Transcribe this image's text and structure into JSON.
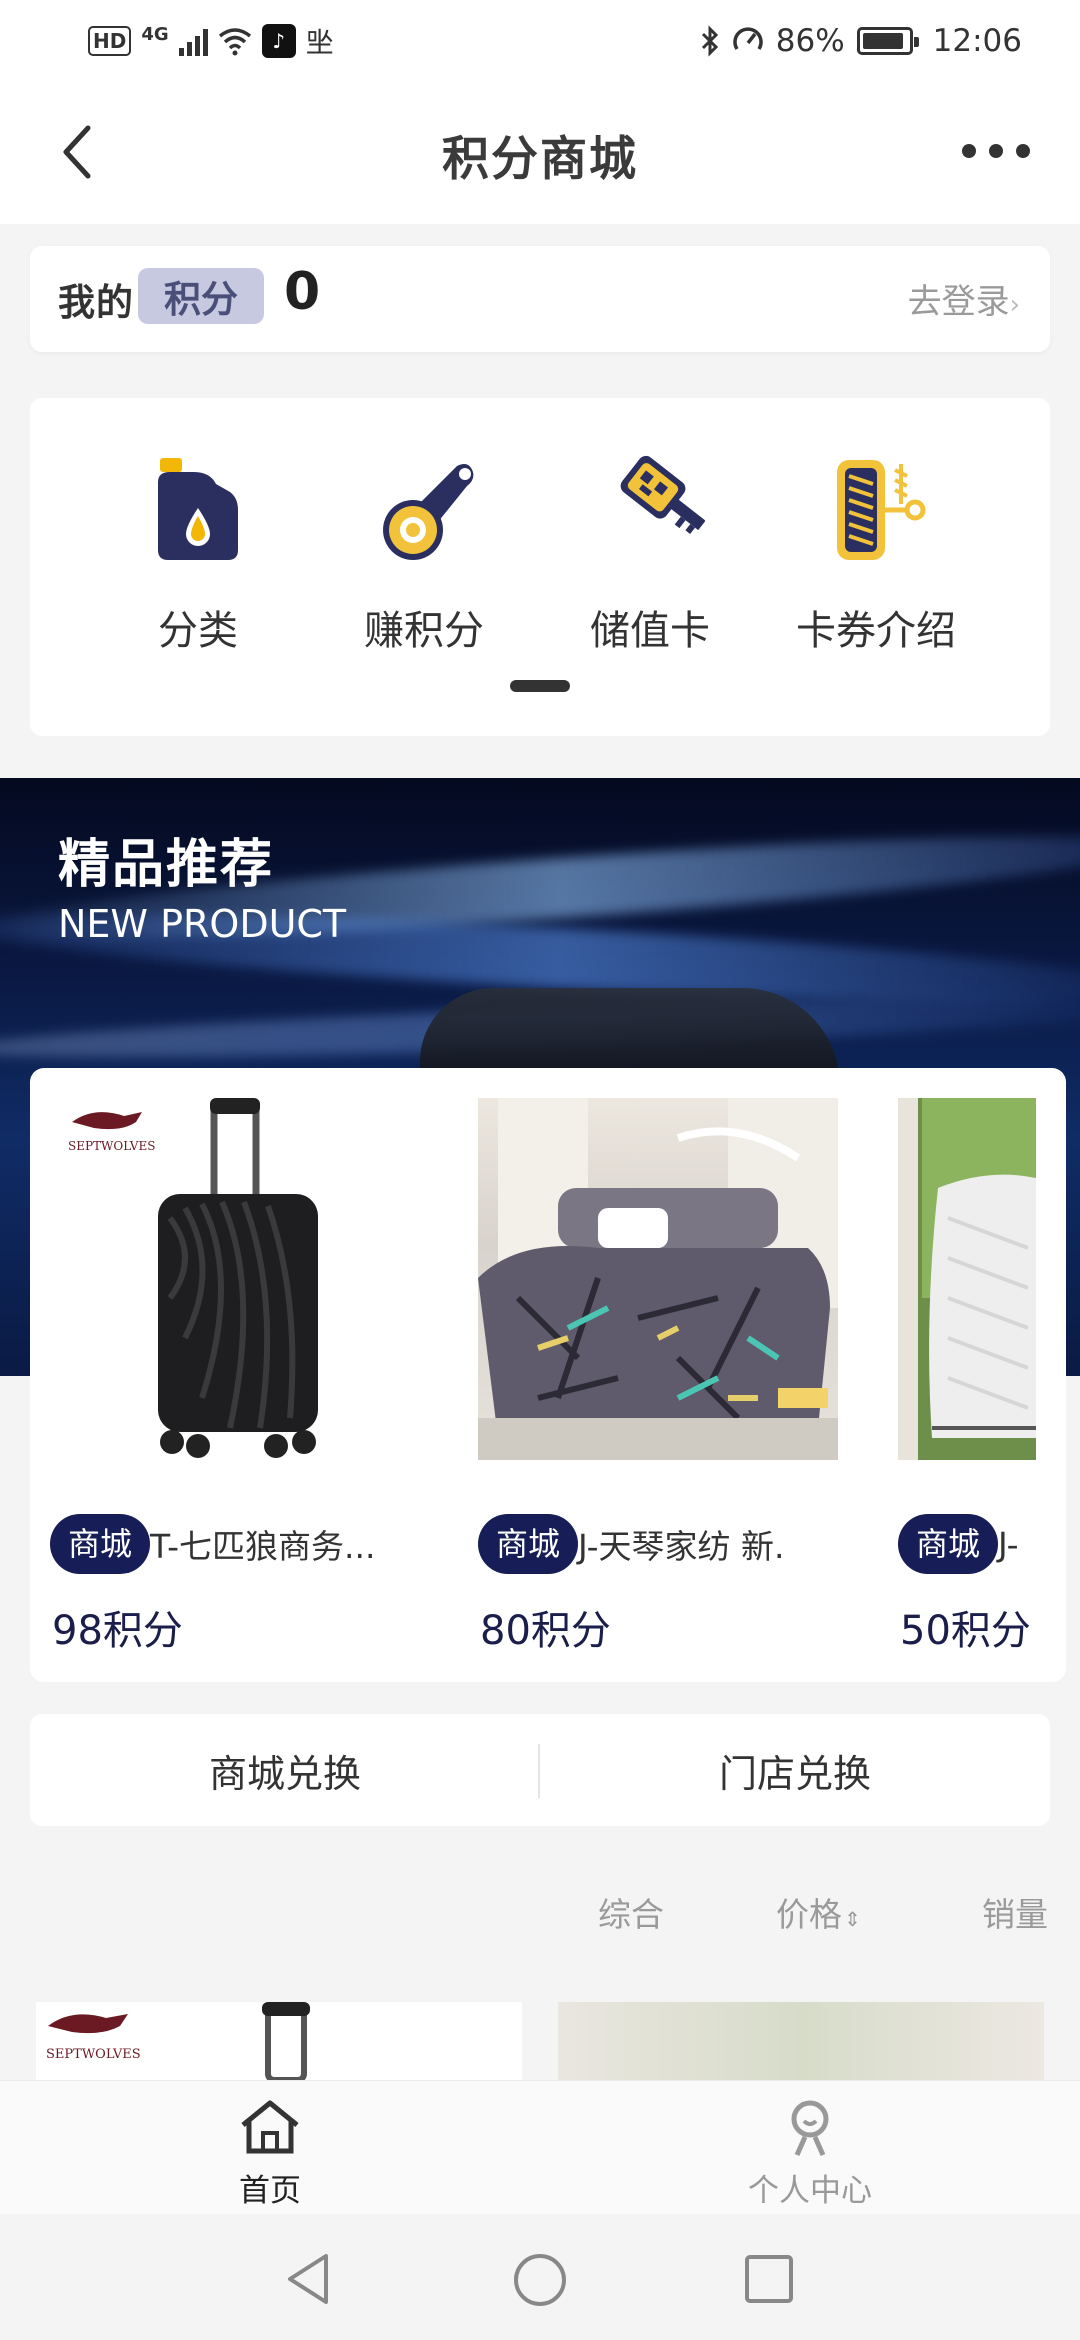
{
  "status_bar": {
    "network": "4G",
    "hd_label": "HD",
    "app_glyph": "♪",
    "extra_glyph": "㘴",
    "battery": "86%",
    "time": "12:06"
  },
  "header": {
    "title": "积分商城"
  },
  "points": {
    "my_label": "我的",
    "badge_label": "积分",
    "value": "0",
    "login_label": "去登录"
  },
  "categories": [
    {
      "label": "分类",
      "icon": "oil-bottle-icon"
    },
    {
      "label": "赚积分",
      "icon": "tape-measure-icon"
    },
    {
      "label": "储值卡",
      "icon": "key-card-icon"
    },
    {
      "label": "卡券介绍",
      "icon": "tire-icon"
    }
  ],
  "banner": {
    "title": "精品推荐",
    "subtitle": "NEW PRODUCT"
  },
  "products": [
    {
      "tag": "商城",
      "name": "T-七匹狼商务...",
      "price": "98积分",
      "brand": "SEPTWOLVES"
    },
    {
      "tag": "商城",
      "name": "J-天琴家纺 新.",
      "price": "80积分"
    },
    {
      "tag": "商城",
      "name": "J-",
      "price": "50积分"
    }
  ],
  "exchange_tabs": [
    "商城兑换",
    "门店兑换"
  ],
  "sort": {
    "comprehensive": "综合",
    "price": "价格",
    "sales": "销量"
  },
  "tabbar": [
    {
      "label": "首页",
      "active": true
    },
    {
      "label": "个人中心",
      "active": false
    }
  ],
  "colors": {
    "accent": "#161d57",
    "badge": "#c7c9e0",
    "price": "#1b1d4a"
  }
}
